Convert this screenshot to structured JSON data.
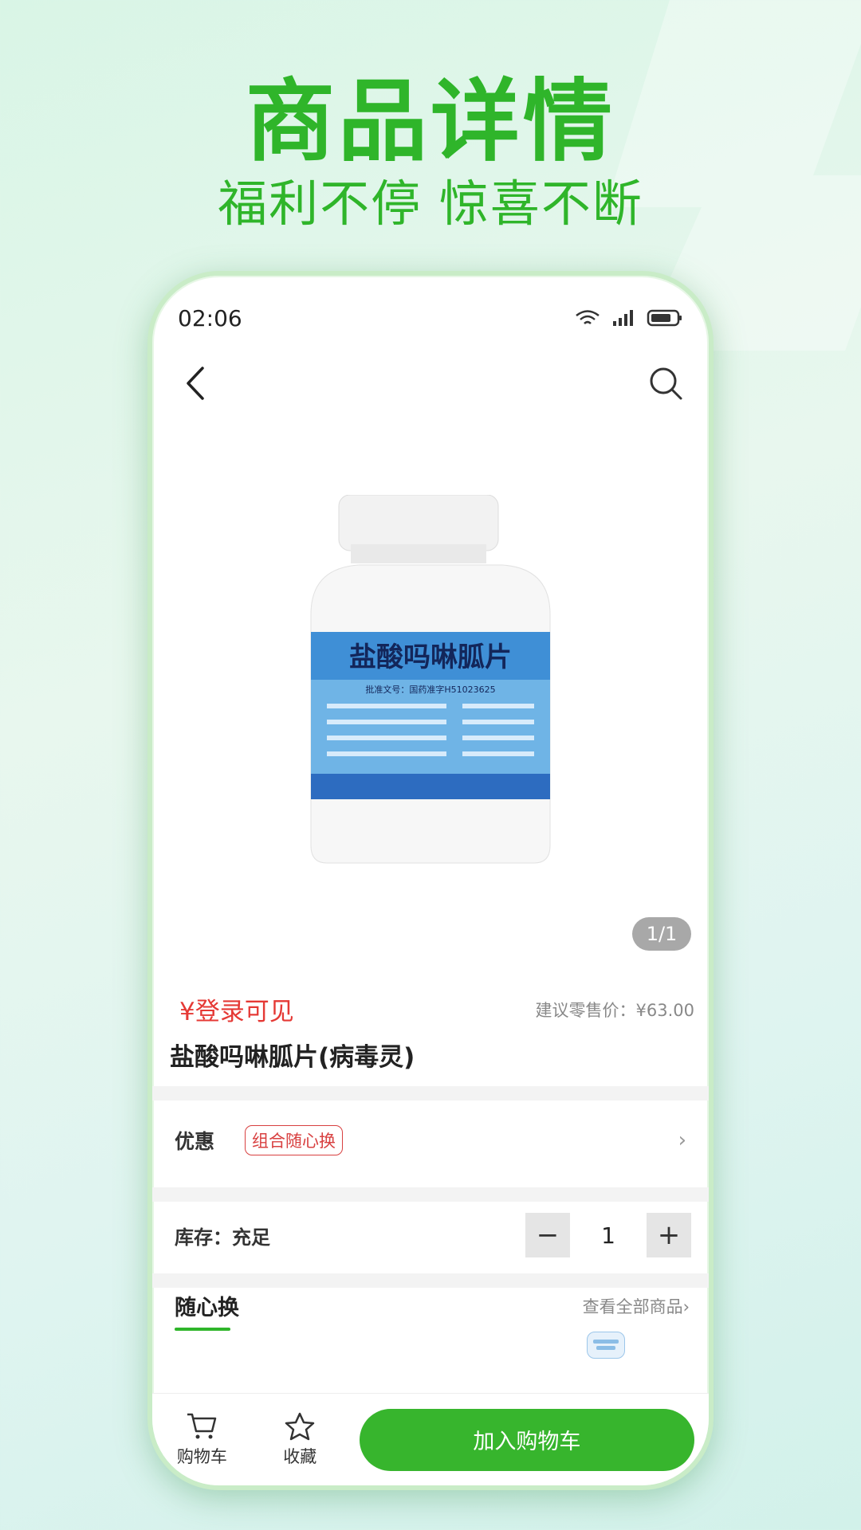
{
  "banner": {
    "headline": "商品详情",
    "subline": "福利不停 惊喜不断"
  },
  "status_bar": {
    "time": "02:06",
    "icons": [
      "wifi-icon",
      "signal-icon",
      "battery-icon"
    ]
  },
  "navbar": {
    "icons": [
      "back-arrow-icon",
      "search-icon"
    ]
  },
  "product": {
    "image_label": "盐酸吗啉胍片",
    "image_approval": "批准文号：国药准字H51023625",
    "pager": "1/1",
    "price": "¥登录可见",
    "msrp": "建议零售价：¥63.00",
    "title": "盐酸吗啉胍片(病毒灵)"
  },
  "promo": {
    "label": "优惠",
    "tag": "组合随心换",
    "arrow": "›"
  },
  "stock": {
    "label": "库存：充足",
    "minus": "−",
    "quantity": "1",
    "plus": "+"
  },
  "section": {
    "title": "随心换",
    "link": "查看全部商品›"
  },
  "bottom_bar": {
    "cart_tab": "购物车",
    "fav_tab": "收藏",
    "add_to_cart": "加入购物车"
  },
  "colors": {
    "brand_green": "#2fb52a",
    "price_red": "#e53935",
    "button_green": "#37b52d"
  }
}
